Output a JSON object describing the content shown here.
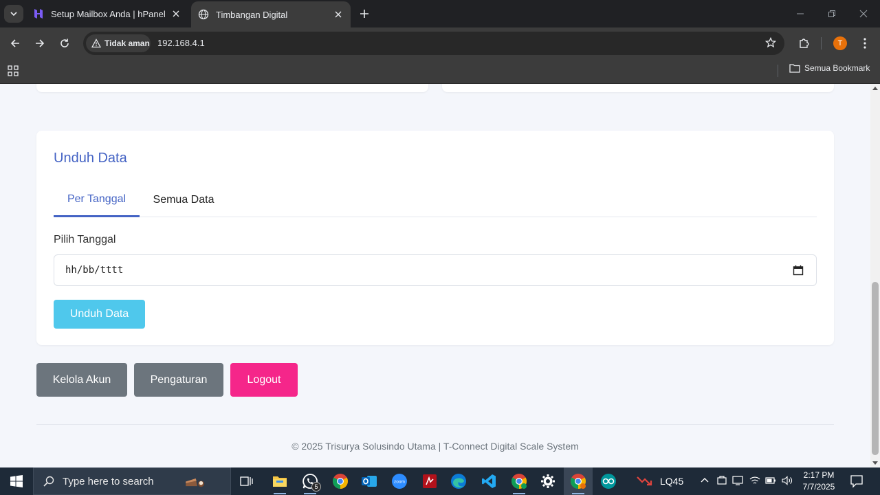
{
  "browser": {
    "tabs": [
      {
        "title": "Setup Mailbox Anda | hPanel",
        "favicon": "hostinger-icon",
        "active": false
      },
      {
        "title": "Timbangan Digital",
        "favicon": "globe-icon",
        "active": true
      }
    ],
    "security_label": "Tidak aman",
    "url": "192.168.4.1",
    "profile_initial": "T",
    "all_bookmarks_label": "Semua Bookmark"
  },
  "page": {
    "download_card": {
      "title": "Unduh Data",
      "tabs": [
        {
          "label": "Per Tanggal",
          "active": true
        },
        {
          "label": "Semua Data",
          "active": false
        }
      ],
      "date_label": "Pilih Tanggal",
      "date_placeholder": "hh/bb/tttt",
      "download_button": "Unduh Data"
    },
    "actions": {
      "manage_accounts": "Kelola Akun",
      "settings": "Pengaturan",
      "logout": "Logout"
    },
    "footer": "© 2025 Trisurya Solusindo Utama | T-Connect Digital Scale System",
    "colors": {
      "accent": "#4463c4",
      "download_button": "#4fc8ec",
      "secondary_button": "#6c757d",
      "logout_button": "#f5268a"
    }
  },
  "taskbar": {
    "search_placeholder": "Type here to search",
    "whatsapp_badge": "5",
    "stock_label": "LQ45",
    "time": "2:17 PM",
    "date": "7/7/2025"
  }
}
